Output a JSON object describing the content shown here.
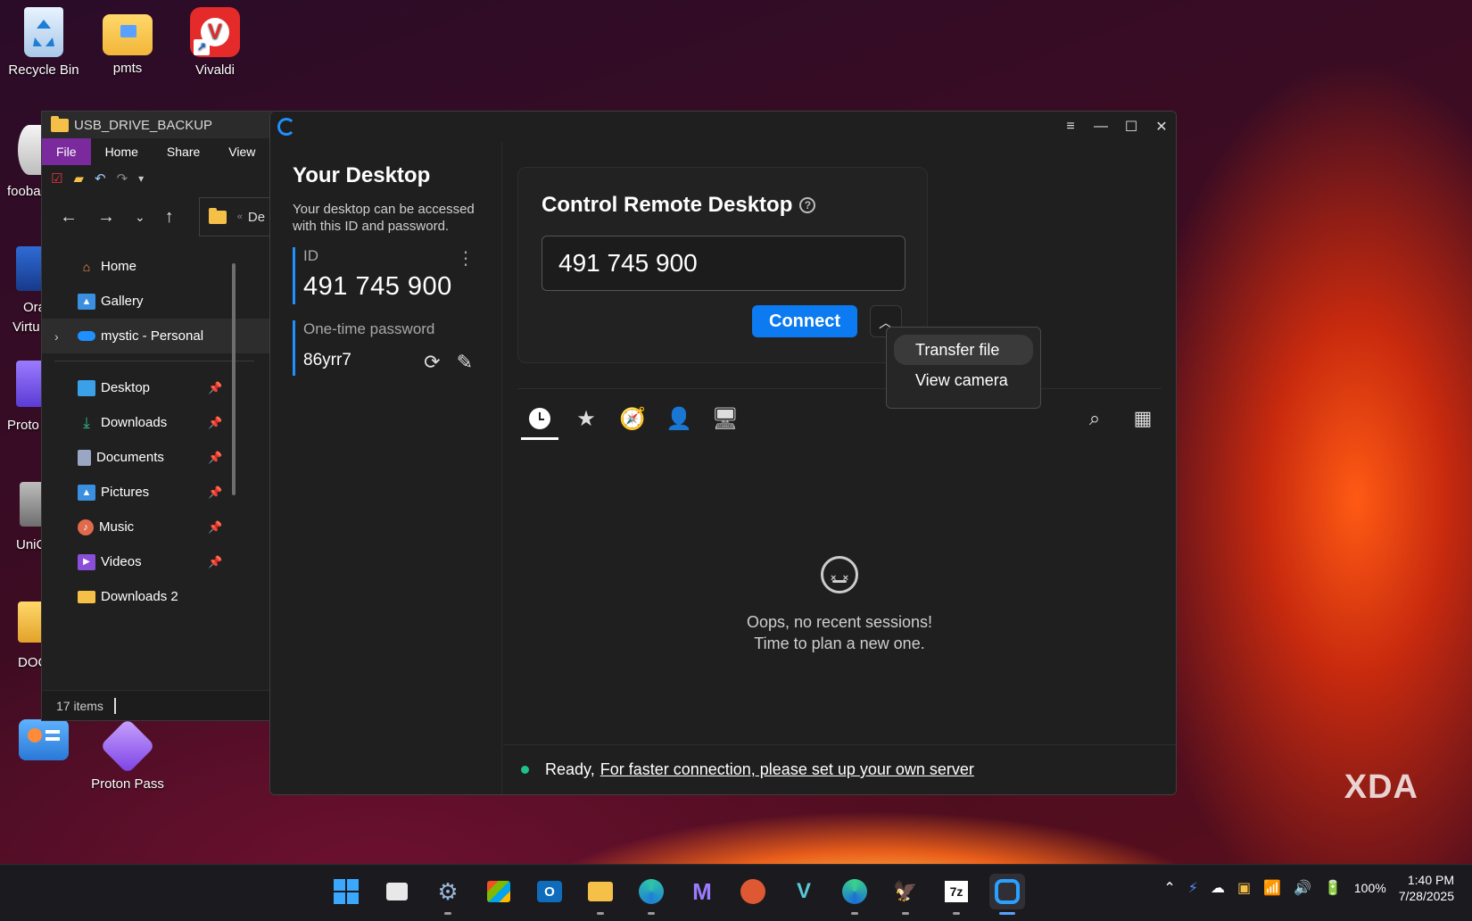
{
  "desktop": {
    "icons": {
      "recycle_bin": "Recycle Bin",
      "pmts": "pmts",
      "vivaldi": "Vivaldi",
      "proton_pass": "Proton Pass"
    },
    "partial_labels": {
      "fooba": "fooba",
      "ora": "Ora",
      "virtu": "Virtu",
      "proto": "Proto",
      "unic": "UniC",
      "doc": "DOC"
    }
  },
  "explorer": {
    "title": "USB_DRIVE_BACKUP",
    "ribbon": [
      "File",
      "Home",
      "Share",
      "View"
    ],
    "path_text": "De",
    "nav": [
      {
        "label": "Home",
        "icon": "home-icon",
        "pinned": false
      },
      {
        "label": "Gallery",
        "icon": "gallery-icon",
        "pinned": false
      },
      {
        "label": "mystic - Personal",
        "icon": "onedrive-icon",
        "pinned": false
      }
    ],
    "quick_access": [
      {
        "label": "Desktop",
        "icon": "desktop-folder-icon",
        "color": "#3aa0e8"
      },
      {
        "label": "Downloads",
        "icon": "download-icon",
        "color": "#2fbf8f"
      },
      {
        "label": "Documents",
        "icon": "documents-icon",
        "color": "#9aa7c4"
      },
      {
        "label": "Pictures",
        "icon": "pictures-icon",
        "color": "#3a8fe0"
      },
      {
        "label": "Music",
        "icon": "music-icon",
        "color": "#e06a4c"
      },
      {
        "label": "Videos",
        "icon": "videos-icon",
        "color": "#8a4fd8"
      },
      {
        "label": "Downloads 2",
        "icon": "folder-icon",
        "color": "#f4c048"
      }
    ],
    "status": "17 items"
  },
  "rustdesk": {
    "left": {
      "title": "Your Desktop",
      "description": "Your desktop can be accessed with this ID and password.",
      "id_label": "ID",
      "id_value": "491 745 900",
      "password_label": "One-time password",
      "password_value": "86yrr7"
    },
    "control": {
      "title": "Control Remote Desktop",
      "id_input_value": "491 745 900",
      "connect_label": "Connect"
    },
    "dropdown_menu": [
      "Transfer file",
      "View camera"
    ],
    "tabs": [
      "recent-sessions",
      "favorites",
      "discovered",
      "address-book",
      "accessible-devices"
    ],
    "empty_state": {
      "line1": "Oops, no recent sessions!",
      "line2": "Time to plan a new one."
    },
    "status": {
      "ready": "Ready,",
      "link": "For faster connection, please set up your own server"
    }
  },
  "taskbar": {
    "tray": {
      "battery": "100%",
      "time": "1:40 PM",
      "date": "7/28/2025"
    }
  },
  "watermark": "XDA",
  "colors": {
    "accent": "#0c7af0",
    "status_ok": "#21c08b",
    "explorer_file_tab": "#7a2a9c"
  }
}
